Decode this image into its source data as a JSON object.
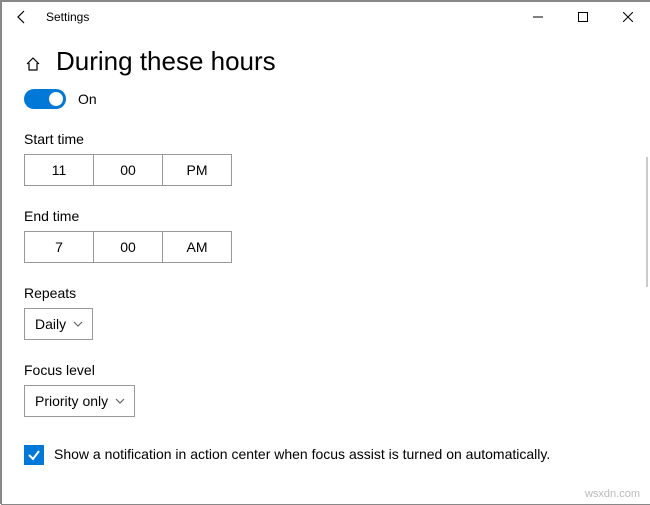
{
  "window": {
    "title": "Settings"
  },
  "page": {
    "heading": "During these hours"
  },
  "toggle": {
    "label": "On",
    "state": true
  },
  "start": {
    "label": "Start time",
    "hour": "11",
    "minute": "00",
    "ampm": "PM"
  },
  "end": {
    "label": "End time",
    "hour": "7",
    "minute": "00",
    "ampm": "AM"
  },
  "repeats": {
    "label": "Repeats",
    "value": "Daily"
  },
  "focus": {
    "label": "Focus level",
    "value": "Priority only"
  },
  "notify": {
    "checked": true,
    "label": "Show a notification in action center when focus assist is turned on automatically."
  },
  "watermark": "wsxdn.com"
}
